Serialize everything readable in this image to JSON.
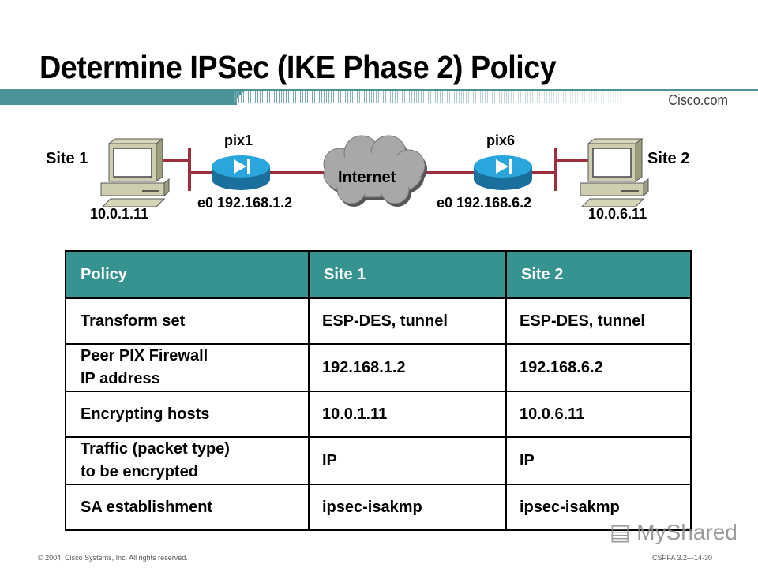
{
  "slide": {
    "title": "Determine IPSec (IKE Phase 2) Policy",
    "brand": "Cisco.com",
    "footer_left": "© 2004, Cisco Systems, Inc. All rights reserved.",
    "footer_right": "CSPFA 3.2—14-30",
    "watermark": "MyShared"
  },
  "diagram": {
    "site1": {
      "label": "Site 1",
      "host_ip": "10.0.1.11"
    },
    "site2": {
      "label": "Site 2",
      "host_ip": "10.0.6.11"
    },
    "pix1": {
      "label": "pix1",
      "interface": "e0 192.168.1.2"
    },
    "pix6": {
      "label": "pix6",
      "interface": "e0 192.168.6.2"
    },
    "cloud": {
      "label": "Internet"
    },
    "colors": {
      "link": "#9b2f3c",
      "router": "#1e8fc9",
      "cloud": "#a8a8a8",
      "banner": "#4a9499",
      "table_header": "#37938f"
    }
  },
  "table": {
    "headers": [
      "Policy",
      "Site 1",
      "Site 2"
    ],
    "rows": [
      {
        "policy": "Transform set",
        "site1": "ESP-DES, tunnel",
        "site2": "ESP-DES, tunnel"
      },
      {
        "policy_line1": "Peer PIX Firewall",
        "policy_line2": "IP address",
        "site1": "192.168.1.2",
        "site2": "192.168.6.2"
      },
      {
        "policy": "Encrypting hosts",
        "site1": "10.0.1.11",
        "site2": "10.0.6.11"
      },
      {
        "policy_line1": "Traffic (packet type)",
        "policy_line2": "to be encrypted",
        "site1": "IP",
        "site2": "IP"
      },
      {
        "policy": "SA establishment",
        "site1": "ipsec-isakmp",
        "site2": "ipsec-isakmp"
      }
    ]
  }
}
